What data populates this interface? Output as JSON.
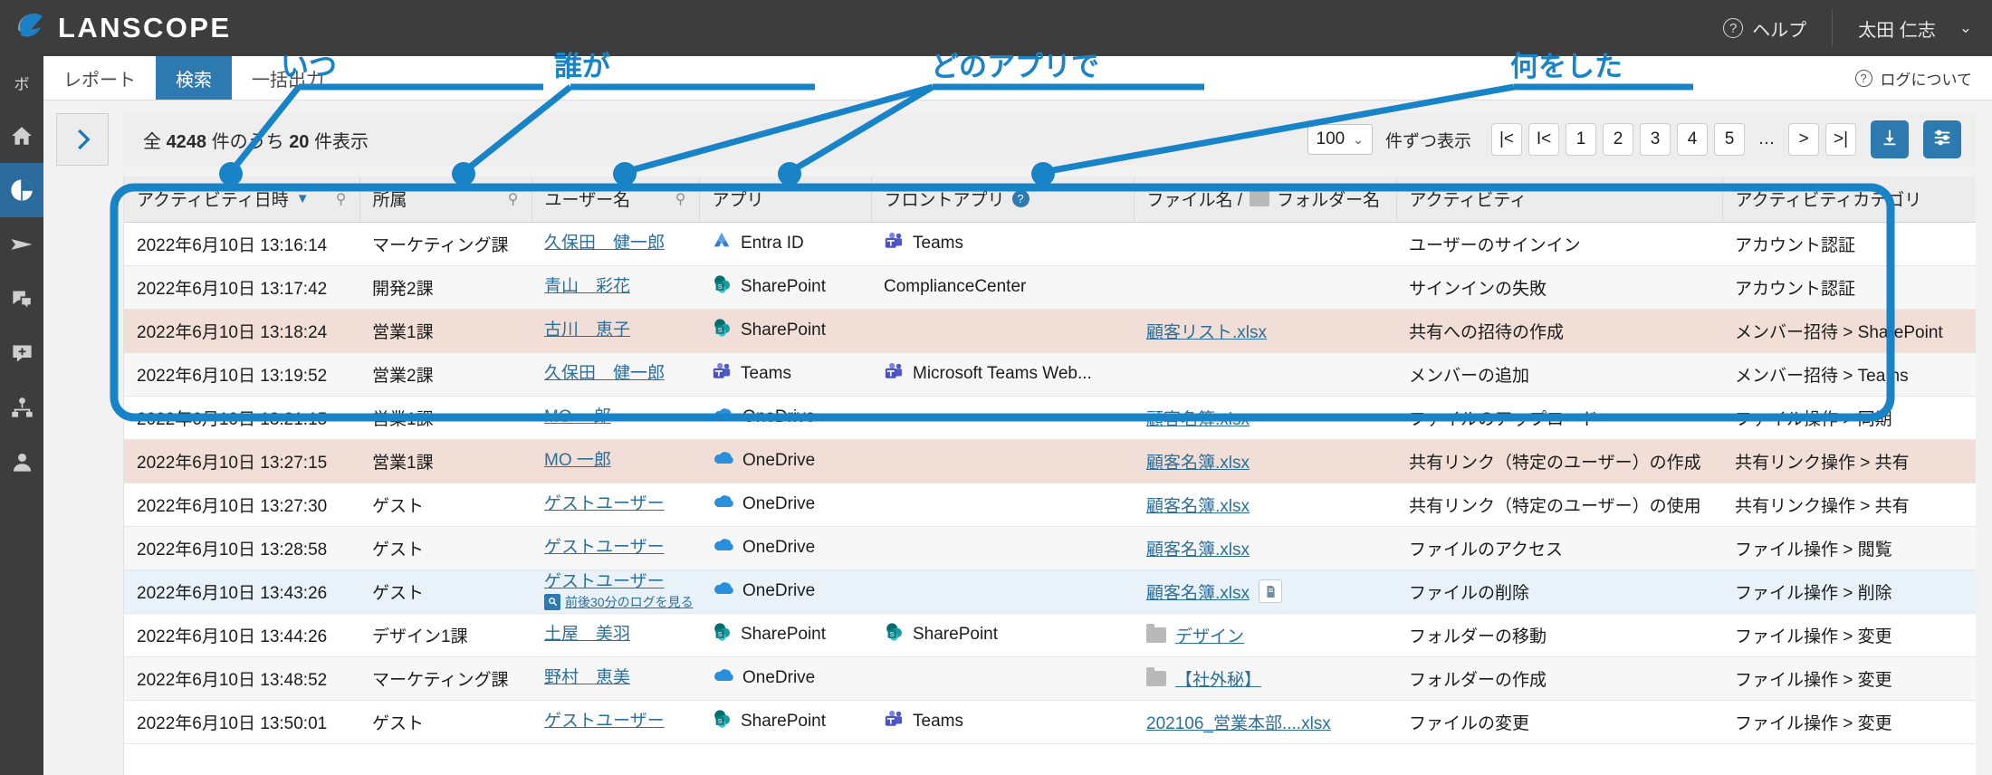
{
  "brand": {
    "name": "LANSCOPE",
    "logo_icon": "lanscope-logo-icon"
  },
  "topbar": {
    "help_label": "ヘルプ",
    "help_icon": "question-circle-icon",
    "user_name": "太田 仁志",
    "user_caret_icon": "chevron-down-icon"
  },
  "rail": {
    "items": [
      {
        "name": "sidebar-item-bo",
        "label": "ボ",
        "icon": "text-bo",
        "active": false
      },
      {
        "name": "sidebar-item-home",
        "label": "",
        "icon": "home-icon",
        "active": false
      },
      {
        "name": "sidebar-item-report",
        "label": "",
        "icon": "pie-chart-icon",
        "active": true
      },
      {
        "name": "sidebar-item-send",
        "label": "",
        "icon": "send-icon",
        "active": false
      },
      {
        "name": "sidebar-item-chat",
        "label": "",
        "icon": "chat-icon",
        "active": false
      },
      {
        "name": "sidebar-item-add-chat",
        "label": "",
        "icon": "chat-plus-icon",
        "active": false
      },
      {
        "name": "sidebar-item-org",
        "label": "",
        "icon": "org-chart-icon",
        "active": false
      },
      {
        "name": "sidebar-item-user",
        "label": "",
        "icon": "person-icon",
        "active": false
      }
    ]
  },
  "tabs": [
    {
      "name": "tab-report",
      "label": "レポート",
      "active": false
    },
    {
      "name": "tab-search",
      "label": "検索",
      "active": true
    },
    {
      "name": "tab-bulk-export",
      "label": "一括出力",
      "active": false
    }
  ],
  "log_about": {
    "label": "ログについて",
    "icon": "question-circle-icon"
  },
  "toolbar": {
    "expand_icon": "chevron-right-icon",
    "count_prefix": "全 ",
    "count_total": "4248",
    "count_middle": " 件のうち ",
    "count_shown": "20",
    "count_suffix": " 件表示",
    "per_page_value": "100",
    "per_page_caret": "chevron-down-icon",
    "per_page_label": "件ずつ表示",
    "pager": [
      "|<",
      "I<",
      "1",
      "2",
      "3",
      "4",
      "5",
      "…",
      ">",
      ">|"
    ],
    "download_icon": "download-icon",
    "settings_icon": "sliders-icon"
  },
  "table": {
    "columns": [
      {
        "name": "col-activity-datetime",
        "label": "アクティビティ日時",
        "sorted": true,
        "pin": true
      },
      {
        "name": "col-department",
        "label": "所属",
        "sorted": false,
        "pin": true
      },
      {
        "name": "col-username",
        "label": "ユーザー名",
        "sorted": false,
        "pin": true
      },
      {
        "name": "col-app",
        "label": "アプリ",
        "sorted": false,
        "pin": false
      },
      {
        "name": "col-front-app",
        "label": "フロントアプリ",
        "sorted": false,
        "pin": false,
        "help": true
      },
      {
        "name": "col-filename",
        "label": "ファイル名 /",
        "label2": "フォルダー名",
        "folder_icon": true
      },
      {
        "name": "col-activity",
        "label": "アクティビティ",
        "sorted": false,
        "pin": false
      },
      {
        "name": "col-activity-category",
        "label": "アクティビティカテゴリ",
        "sorted": false,
        "pin": false
      }
    ],
    "rows": [
      {
        "datetime": "2022年6月10日 13:16:14",
        "dept": "マーケティング課",
        "user": "久保田　健一郎",
        "user_sub": "",
        "app": "Entra ID",
        "app_icon": "entra-id-icon",
        "front_app": "Teams",
        "front_icon": "teams-icon",
        "file": "",
        "file_icon": "",
        "file_link": false,
        "file_badge": false,
        "activity": "ユーザーのサインイン",
        "category": "アカウント認証",
        "style": "plain"
      },
      {
        "datetime": "2022年6月10日 13:17:42",
        "dept": "開発2課",
        "user": "青山　彩花",
        "user_sub": "",
        "app": "SharePoint",
        "app_icon": "sharepoint-icon",
        "front_app": "ComplianceCenter",
        "front_icon": "",
        "file": "",
        "file_icon": "",
        "file_link": false,
        "file_badge": false,
        "activity": "サインインの失敗",
        "category": "アカウント認証",
        "style": "alt"
      },
      {
        "datetime": "2022年6月10日 13:18:24",
        "dept": "営業1課",
        "user": "古川　恵子",
        "user_sub": "",
        "app": "SharePoint",
        "app_icon": "sharepoint-icon",
        "front_app": "",
        "front_icon": "",
        "file": "顧客リスト.xlsx",
        "file_icon": "",
        "file_link": true,
        "file_badge": false,
        "activity": "共有への招待の作成",
        "category": "メンバー招待 > SharePoint",
        "style": "warn"
      },
      {
        "datetime": "2022年6月10日 13:19:52",
        "dept": "営業2課",
        "user": "久保田　健一郎",
        "user_sub": "",
        "app": "Teams",
        "app_icon": "teams-icon",
        "front_app": "Microsoft Teams Web...",
        "front_icon": "teams-icon",
        "file": "",
        "file_icon": "",
        "file_link": false,
        "file_badge": false,
        "activity": "メンバーの追加",
        "category": "メンバー招待 > Teams",
        "style": "alt"
      },
      {
        "datetime": "2022年6月10日 13:21:15",
        "dept": "営業1課",
        "user": "MO 一郎",
        "user_sub": "",
        "app": "OneDrive",
        "app_icon": "onedrive-icon",
        "front_app": "",
        "front_icon": "",
        "file": "顧客名簿.xlsx",
        "file_icon": "",
        "file_link": true,
        "file_badge": false,
        "activity": "ファイルのアップロード",
        "category": "ファイル操作 > 同期",
        "style": "plain"
      },
      {
        "datetime": "2022年6月10日 13:27:15",
        "dept": "営業1課",
        "user": "MO 一郎",
        "user_sub": "",
        "app": "OneDrive",
        "app_icon": "onedrive-icon",
        "front_app": "",
        "front_icon": "",
        "file": "顧客名簿.xlsx",
        "file_icon": "",
        "file_link": true,
        "file_badge": false,
        "activity": "共有リンク（特定のユーザー）の作成",
        "category": "共有リンク操作 > 共有",
        "style": "warn"
      },
      {
        "datetime": "2022年6月10日 13:27:30",
        "dept": "ゲスト",
        "user": "ゲストユーザー",
        "user_sub": "",
        "app": "OneDrive",
        "app_icon": "onedrive-icon",
        "front_app": "",
        "front_icon": "",
        "file": "顧客名簿.xlsx",
        "file_icon": "",
        "file_link": true,
        "file_badge": false,
        "activity": "共有リンク（特定のユーザー）の使用",
        "category": "共有リンク操作 > 共有",
        "style": "plain"
      },
      {
        "datetime": "2022年6月10日 13:28:58",
        "dept": "ゲスト",
        "user": "ゲストユーザー",
        "user_sub": "",
        "app": "OneDrive",
        "app_icon": "onedrive-icon",
        "front_app": "",
        "front_icon": "",
        "file": "顧客名簿.xlsx",
        "file_icon": "",
        "file_link": true,
        "file_badge": false,
        "activity": "ファイルのアクセス",
        "category": "ファイル操作 > 閲覧",
        "style": "alt"
      },
      {
        "datetime": "2022年6月10日 13:43:26",
        "dept": "ゲスト",
        "user": "ゲストユーザー",
        "user_sub": "前後30分のログを見る",
        "app": "OneDrive",
        "app_icon": "onedrive-icon",
        "front_app": "",
        "front_icon": "",
        "file": "顧客名簿.xlsx",
        "file_icon": "",
        "file_link": true,
        "file_badge": true,
        "activity": "ファイルの削除",
        "category": "ファイル操作 > 削除",
        "style": "sel"
      },
      {
        "datetime": "2022年6月10日 13:44:26",
        "dept": "デザイン1課",
        "user": "土屋　美羽",
        "user_sub": "",
        "app": "SharePoint",
        "app_icon": "sharepoint-icon",
        "front_app": "SharePoint",
        "front_icon": "sharepoint-icon",
        "file": "デザイン",
        "file_icon": "folder-icon",
        "file_link": true,
        "file_badge": false,
        "activity": "フォルダーの移動",
        "category": "ファイル操作 > 変更",
        "style": "plain"
      },
      {
        "datetime": "2022年6月10日 13:48:52",
        "dept": "マーケティング課",
        "user": "野村　恵美",
        "user_sub": "",
        "app": "OneDrive",
        "app_icon": "onedrive-icon",
        "front_app": "",
        "front_icon": "",
        "file": "【社外秘】",
        "file_icon": "folder-icon",
        "file_link": true,
        "file_badge": false,
        "activity": "フォルダーの作成",
        "category": "ファイル操作 > 変更",
        "style": "alt"
      },
      {
        "datetime": "2022年6月10日 13:50:01",
        "dept": "ゲスト",
        "user": "ゲストユーザー",
        "user_sub": "",
        "app": "SharePoint",
        "app_icon": "sharepoint-icon",
        "front_app": "Teams",
        "front_icon": "teams-icon",
        "file": "202106_営業本部....xlsx",
        "file_icon": "",
        "file_link": true,
        "file_badge": false,
        "activity": "ファイルの変更",
        "category": "ファイル操作 > 変更",
        "style": "plain"
      }
    ]
  },
  "annotations": [
    {
      "name": "callout-when",
      "label": "いつ"
    },
    {
      "name": "callout-who",
      "label": "誰が"
    },
    {
      "name": "callout-which-app",
      "label": "どのアプリで"
    },
    {
      "name": "callout-what",
      "label": "何をした"
    }
  ],
  "colors": {
    "brand_dark": "#3d3d3d",
    "accent_blue": "#2c7ab0",
    "callout_blue": "#1884c7",
    "warn_row": "#f0ded7",
    "selected_row": "#e8f2f8",
    "link": "#2b6f9c"
  }
}
